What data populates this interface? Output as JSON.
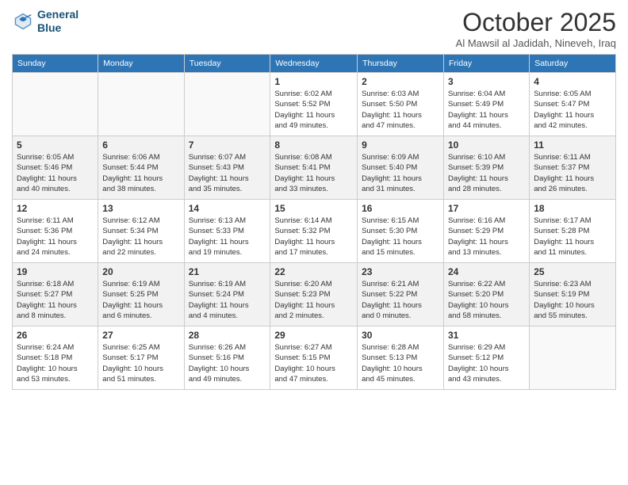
{
  "header": {
    "logo_line1": "General",
    "logo_line2": "Blue",
    "month": "October 2025",
    "location": "Al Mawsil al Jadidah, Nineveh, Iraq"
  },
  "days_of_week": [
    "Sunday",
    "Monday",
    "Tuesday",
    "Wednesday",
    "Thursday",
    "Friday",
    "Saturday"
  ],
  "weeks": [
    [
      {
        "day": "",
        "info": ""
      },
      {
        "day": "",
        "info": ""
      },
      {
        "day": "",
        "info": ""
      },
      {
        "day": "1",
        "info": "Sunrise: 6:02 AM\nSunset: 5:52 PM\nDaylight: 11 hours\nand 49 minutes."
      },
      {
        "day": "2",
        "info": "Sunrise: 6:03 AM\nSunset: 5:50 PM\nDaylight: 11 hours\nand 47 minutes."
      },
      {
        "day": "3",
        "info": "Sunrise: 6:04 AM\nSunset: 5:49 PM\nDaylight: 11 hours\nand 44 minutes."
      },
      {
        "day": "4",
        "info": "Sunrise: 6:05 AM\nSunset: 5:47 PM\nDaylight: 11 hours\nand 42 minutes."
      }
    ],
    [
      {
        "day": "5",
        "info": "Sunrise: 6:05 AM\nSunset: 5:46 PM\nDaylight: 11 hours\nand 40 minutes."
      },
      {
        "day": "6",
        "info": "Sunrise: 6:06 AM\nSunset: 5:44 PM\nDaylight: 11 hours\nand 38 minutes."
      },
      {
        "day": "7",
        "info": "Sunrise: 6:07 AM\nSunset: 5:43 PM\nDaylight: 11 hours\nand 35 minutes."
      },
      {
        "day": "8",
        "info": "Sunrise: 6:08 AM\nSunset: 5:41 PM\nDaylight: 11 hours\nand 33 minutes."
      },
      {
        "day": "9",
        "info": "Sunrise: 6:09 AM\nSunset: 5:40 PM\nDaylight: 11 hours\nand 31 minutes."
      },
      {
        "day": "10",
        "info": "Sunrise: 6:10 AM\nSunset: 5:39 PM\nDaylight: 11 hours\nand 28 minutes."
      },
      {
        "day": "11",
        "info": "Sunrise: 6:11 AM\nSunset: 5:37 PM\nDaylight: 11 hours\nand 26 minutes."
      }
    ],
    [
      {
        "day": "12",
        "info": "Sunrise: 6:11 AM\nSunset: 5:36 PM\nDaylight: 11 hours\nand 24 minutes."
      },
      {
        "day": "13",
        "info": "Sunrise: 6:12 AM\nSunset: 5:34 PM\nDaylight: 11 hours\nand 22 minutes."
      },
      {
        "day": "14",
        "info": "Sunrise: 6:13 AM\nSunset: 5:33 PM\nDaylight: 11 hours\nand 19 minutes."
      },
      {
        "day": "15",
        "info": "Sunrise: 6:14 AM\nSunset: 5:32 PM\nDaylight: 11 hours\nand 17 minutes."
      },
      {
        "day": "16",
        "info": "Sunrise: 6:15 AM\nSunset: 5:30 PM\nDaylight: 11 hours\nand 15 minutes."
      },
      {
        "day": "17",
        "info": "Sunrise: 6:16 AM\nSunset: 5:29 PM\nDaylight: 11 hours\nand 13 minutes."
      },
      {
        "day": "18",
        "info": "Sunrise: 6:17 AM\nSunset: 5:28 PM\nDaylight: 11 hours\nand 11 minutes."
      }
    ],
    [
      {
        "day": "19",
        "info": "Sunrise: 6:18 AM\nSunset: 5:27 PM\nDaylight: 11 hours\nand 8 minutes."
      },
      {
        "day": "20",
        "info": "Sunrise: 6:19 AM\nSunset: 5:25 PM\nDaylight: 11 hours\nand 6 minutes."
      },
      {
        "day": "21",
        "info": "Sunrise: 6:19 AM\nSunset: 5:24 PM\nDaylight: 11 hours\nand 4 minutes."
      },
      {
        "day": "22",
        "info": "Sunrise: 6:20 AM\nSunset: 5:23 PM\nDaylight: 11 hours\nand 2 minutes."
      },
      {
        "day": "23",
        "info": "Sunrise: 6:21 AM\nSunset: 5:22 PM\nDaylight: 11 hours\nand 0 minutes."
      },
      {
        "day": "24",
        "info": "Sunrise: 6:22 AM\nSunset: 5:20 PM\nDaylight: 10 hours\nand 58 minutes."
      },
      {
        "day": "25",
        "info": "Sunrise: 6:23 AM\nSunset: 5:19 PM\nDaylight: 10 hours\nand 55 minutes."
      }
    ],
    [
      {
        "day": "26",
        "info": "Sunrise: 6:24 AM\nSunset: 5:18 PM\nDaylight: 10 hours\nand 53 minutes."
      },
      {
        "day": "27",
        "info": "Sunrise: 6:25 AM\nSunset: 5:17 PM\nDaylight: 10 hours\nand 51 minutes."
      },
      {
        "day": "28",
        "info": "Sunrise: 6:26 AM\nSunset: 5:16 PM\nDaylight: 10 hours\nand 49 minutes."
      },
      {
        "day": "29",
        "info": "Sunrise: 6:27 AM\nSunset: 5:15 PM\nDaylight: 10 hours\nand 47 minutes."
      },
      {
        "day": "30",
        "info": "Sunrise: 6:28 AM\nSunset: 5:13 PM\nDaylight: 10 hours\nand 45 minutes."
      },
      {
        "day": "31",
        "info": "Sunrise: 6:29 AM\nSunset: 5:12 PM\nDaylight: 10 hours\nand 43 minutes."
      },
      {
        "day": "",
        "info": ""
      }
    ]
  ]
}
